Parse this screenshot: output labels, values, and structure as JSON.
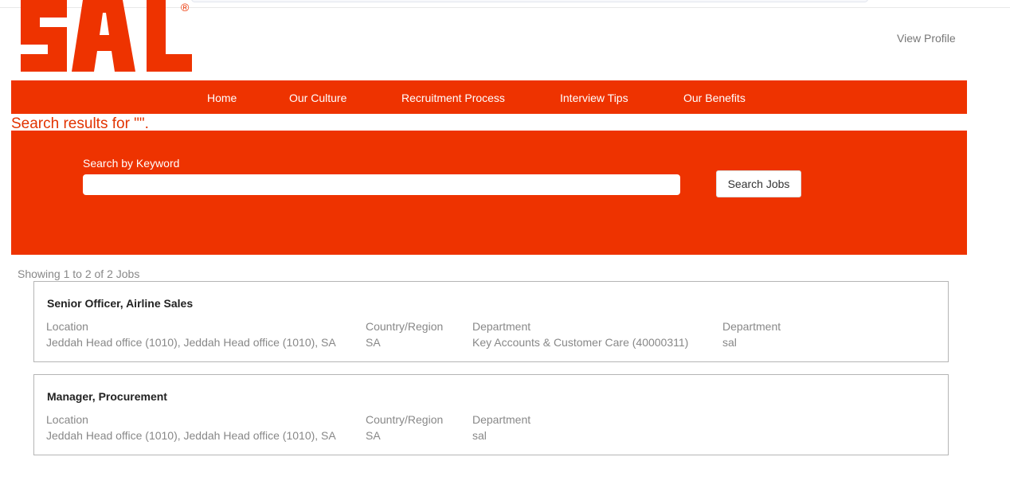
{
  "brand": {
    "logo_text": "SAL",
    "registered_mark": "®",
    "accent_color": "#ee3300"
  },
  "header": {
    "view_profile": "View Profile"
  },
  "nav": {
    "items": [
      {
        "label": "Home"
      },
      {
        "label": "Our Culture"
      },
      {
        "label": "Recruitment Process"
      },
      {
        "label": "Interview Tips"
      },
      {
        "label": "Our Benefits"
      }
    ]
  },
  "search": {
    "results_heading": "Search results for \"\".",
    "keyword_label": "Search by Keyword",
    "keyword_value": "",
    "button_label": "Search Jobs"
  },
  "results": {
    "summary": "Showing 1 to 2 of 2 Jobs",
    "jobs": [
      {
        "title": "Senior Officer, Airline Sales",
        "fields": [
          {
            "label": "Location",
            "value": "Jeddah Head office (1010), Jeddah Head office (1010), SA"
          },
          {
            "label": "Country/Region",
            "value": "SA"
          },
          {
            "label": "Department",
            "value": "Key Accounts & Customer Care (40000311)"
          },
          {
            "label": "Department",
            "value": "sal"
          }
        ]
      },
      {
        "title": "Manager, Procurement",
        "fields": [
          {
            "label": "Location",
            "value": "Jeddah Head office (1010), Jeddah Head office (1010), SA"
          },
          {
            "label": "Country/Region",
            "value": "SA"
          },
          {
            "label": "Department",
            "value": "sal"
          }
        ]
      }
    ]
  }
}
